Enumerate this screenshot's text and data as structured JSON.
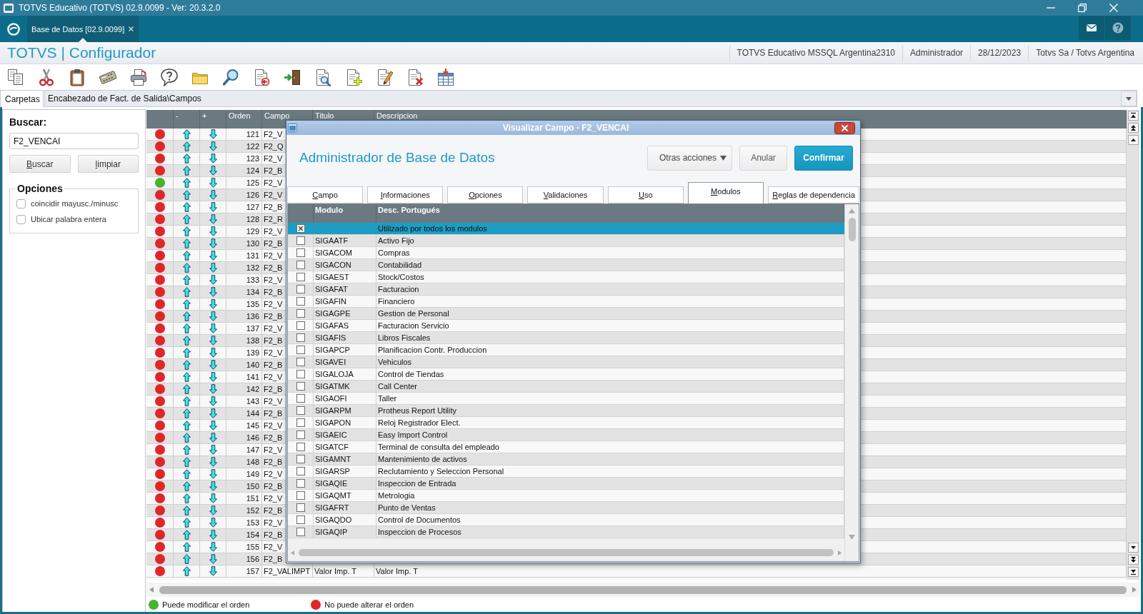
{
  "window": {
    "title": "TOTVS Educativo (TOTVS) 02.9.0099 - Ver: 20.3.2.0"
  },
  "app_tabs": [
    {
      "label": "Base de Datos [02.9.0099]",
      "selected": true
    }
  ],
  "header": {
    "title": "TOTVS | Configurador",
    "info": [
      "TOTVS Educativo MSSQL Argentina2310",
      "Administrador",
      "28/12/2023",
      "Totvs Sa / Totvs Argentina"
    ]
  },
  "breadcrumb": {
    "tab": "Carpetas",
    "path": "Encabezado de Fact. de Salida\\Campos"
  },
  "search_panel": {
    "label": "Buscar:",
    "value": "F2_VENCAI",
    "buttons": [
      "Buscar",
      "limpiar"
    ],
    "options_title": "Opciones",
    "options": [
      {
        "label": "coincidir mayusc./minusc",
        "checked": false
      },
      {
        "label": "Ubicar palabra entera",
        "checked": false
      }
    ]
  },
  "fields_table": {
    "columns": [
      "-",
      "+",
      "Orden",
      "Campo",
      "Titulo",
      "Descripcion"
    ],
    "rows": [
      {
        "color": "#e0262b",
        "order": "121",
        "campo": "F2_V"
      },
      {
        "color": "#e0262b",
        "order": "122",
        "campo": "F2_Q"
      },
      {
        "color": "#e0262b",
        "order": "123",
        "campo": "F2_V"
      },
      {
        "color": "#e0262b",
        "order": "124",
        "campo": "F2_B"
      },
      {
        "color": "#43b52f",
        "order": "125",
        "campo": "F2_V"
      },
      {
        "color": "#e0262b",
        "order": "126",
        "campo": "F2_V"
      },
      {
        "color": "#e0262b",
        "order": "127",
        "campo": "F2_B"
      },
      {
        "color": "#e0262b",
        "order": "128",
        "campo": "F2_R"
      },
      {
        "color": "#e0262b",
        "order": "129",
        "campo": "F2_V"
      },
      {
        "color": "#e0262b",
        "order": "130",
        "campo": "F2_B"
      },
      {
        "color": "#e0262b",
        "order": "131",
        "campo": "F2_V"
      },
      {
        "color": "#e0262b",
        "order": "132",
        "campo": "F2_B"
      },
      {
        "color": "#e0262b",
        "order": "133",
        "campo": "F2_V"
      },
      {
        "color": "#e0262b",
        "order": "134",
        "campo": "F2_B"
      },
      {
        "color": "#e0262b",
        "order": "135",
        "campo": "F2_V"
      },
      {
        "color": "#e0262b",
        "order": "136",
        "campo": "F2_B"
      },
      {
        "color": "#e0262b",
        "order": "137",
        "campo": "F2_V"
      },
      {
        "color": "#e0262b",
        "order": "138",
        "campo": "F2_B"
      },
      {
        "color": "#e0262b",
        "order": "139",
        "campo": "F2_V"
      },
      {
        "color": "#e0262b",
        "order": "140",
        "campo": "F2_B"
      },
      {
        "color": "#e0262b",
        "order": "141",
        "campo": "F2_V"
      },
      {
        "color": "#e0262b",
        "order": "142",
        "campo": "F2_B"
      },
      {
        "color": "#e0262b",
        "order": "143",
        "campo": "F2_V"
      },
      {
        "color": "#e0262b",
        "order": "144",
        "campo": "F2_B"
      },
      {
        "color": "#e0262b",
        "order": "145",
        "campo": "F2_V"
      },
      {
        "color": "#e0262b",
        "order": "146",
        "campo": "F2_B"
      },
      {
        "color": "#e0262b",
        "order": "147",
        "campo": "F2_V"
      },
      {
        "color": "#e0262b",
        "order": "148",
        "campo": "F2_B"
      },
      {
        "color": "#e0262b",
        "order": "149",
        "campo": "F2_V"
      },
      {
        "color": "#e0262b",
        "order": "150",
        "campo": "F2_B"
      },
      {
        "color": "#e0262b",
        "order": "151",
        "campo": "F2_V"
      },
      {
        "color": "#e0262b",
        "order": "152",
        "campo": "F2_B"
      },
      {
        "color": "#e0262b",
        "order": "153",
        "campo": "F2_V"
      },
      {
        "color": "#e0262b",
        "order": "154",
        "campo": "F2_B"
      },
      {
        "color": "#e0262b",
        "order": "155",
        "campo": "F2_V"
      },
      {
        "color": "#e0262b",
        "order": "156",
        "campo": "F2_B"
      },
      {
        "color": "#e0262b",
        "order": "157",
        "campo": "F2_VALIMPT",
        "titulo": "Valor Imp. T",
        "descripcion": "Valor Imp. T"
      }
    ]
  },
  "legend": [
    {
      "color": "#43b52f",
      "label": "Puede modificar el orden"
    },
    {
      "color": "#e0262b",
      "label": "No puede alterar el orden"
    }
  ],
  "dialog": {
    "title": "Visualizar Campo - F2_VENCAI",
    "heading": "Administrador de Base de Datos",
    "actions": [
      {
        "label": "Otras acciones",
        "kind": "menu"
      },
      {
        "label": "Anular",
        "kind": "secondary"
      },
      {
        "label": "Confirmar",
        "kind": "primary"
      }
    ],
    "tabs": [
      {
        "label": "Campo",
        "selected": false
      },
      {
        "label": "Informaciones",
        "selected": false
      },
      {
        "label": "Opciones",
        "selected": false
      },
      {
        "label": "Validaciones",
        "selected": false
      },
      {
        "label": "Uso",
        "selected": false
      },
      {
        "label": "Modulos",
        "selected": true
      },
      {
        "label": "Reglas de dependencia",
        "selected": false
      }
    ],
    "modules": {
      "columns": [
        "Modulo",
        "Desc. Portugués"
      ],
      "rows": [
        {
          "checked": true,
          "selected": true,
          "description": "Utilizado por todos los modulos"
        },
        {
          "checked": false,
          "selected": false,
          "code": "SIGAATF",
          "description": "Activo Fijo"
        },
        {
          "checked": false,
          "selected": false,
          "code": "SIGACOM",
          "description": "Compras"
        },
        {
          "checked": false,
          "selected": false,
          "code": "SIGACON",
          "description": "Contabilidad"
        },
        {
          "checked": false,
          "selected": false,
          "code": "SIGAEST",
          "description": "Stock/Costos"
        },
        {
          "checked": false,
          "selected": false,
          "code": "SIGAFAT",
          "description": "Facturacion"
        },
        {
          "checked": false,
          "selected": false,
          "code": "SIGAFIN",
          "description": "Financiero"
        },
        {
          "checked": false,
          "selected": false,
          "code": "SIGAGPE",
          "description": "Gestion de Personal"
        },
        {
          "checked": false,
          "selected": false,
          "code": "SIGAFAS",
          "description": "Facturacion Servicio"
        },
        {
          "checked": false,
          "selected": false,
          "code": "SIGAFIS",
          "description": "Libros Fiscales"
        },
        {
          "checked": false,
          "selected": false,
          "code": "SIGAPCP",
          "description": "Planificacion Contr. Produccion"
        },
        {
          "checked": false,
          "selected": false,
          "code": "SIGAVEI",
          "description": "Vehiculos"
        },
        {
          "checked": false,
          "selected": false,
          "code": "SIGALOJA",
          "description": "Control de Tiendas"
        },
        {
          "checked": false,
          "selected": false,
          "code": "SIGATMK",
          "description": "Call Center"
        },
        {
          "checked": false,
          "selected": false,
          "code": "SIGAOFI",
          "description": "Taller"
        },
        {
          "checked": false,
          "selected": false,
          "code": "SIGARPM",
          "description": "Protheus Report Utility"
        },
        {
          "checked": false,
          "selected": false,
          "code": "SIGAPON",
          "description": "Reloj Registrador Elect."
        },
        {
          "checked": false,
          "selected": false,
          "code": "SIGAEIC",
          "description": "Easy Import Control"
        },
        {
          "checked": false,
          "selected": false,
          "code": "SIGATCF",
          "description": "Terminal de consulta del empleado"
        },
        {
          "checked": false,
          "selected": false,
          "code": "SIGAMNT",
          "description": "Mantenimiento de activos"
        },
        {
          "checked": false,
          "selected": false,
          "code": "SIGARSP",
          "description": "Reclutamiento y Seleccion Personal"
        },
        {
          "checked": false,
          "selected": false,
          "code": "SIGAQIE",
          "description": "Inspeccion de Entrada"
        },
        {
          "checked": false,
          "selected": false,
          "code": "SIGAQMT",
          "description": "Metrologia"
        },
        {
          "checked": false,
          "selected": false,
          "code": "SIGAFRT",
          "description": "Punto de Ventas"
        },
        {
          "checked": false,
          "selected": false,
          "code": "SIGAQDO",
          "description": "Control de Documentos"
        },
        {
          "checked": false,
          "selected": false,
          "code": "SIGAQIP",
          "description": "Inspeccion de Procesos"
        }
      ]
    }
  }
}
